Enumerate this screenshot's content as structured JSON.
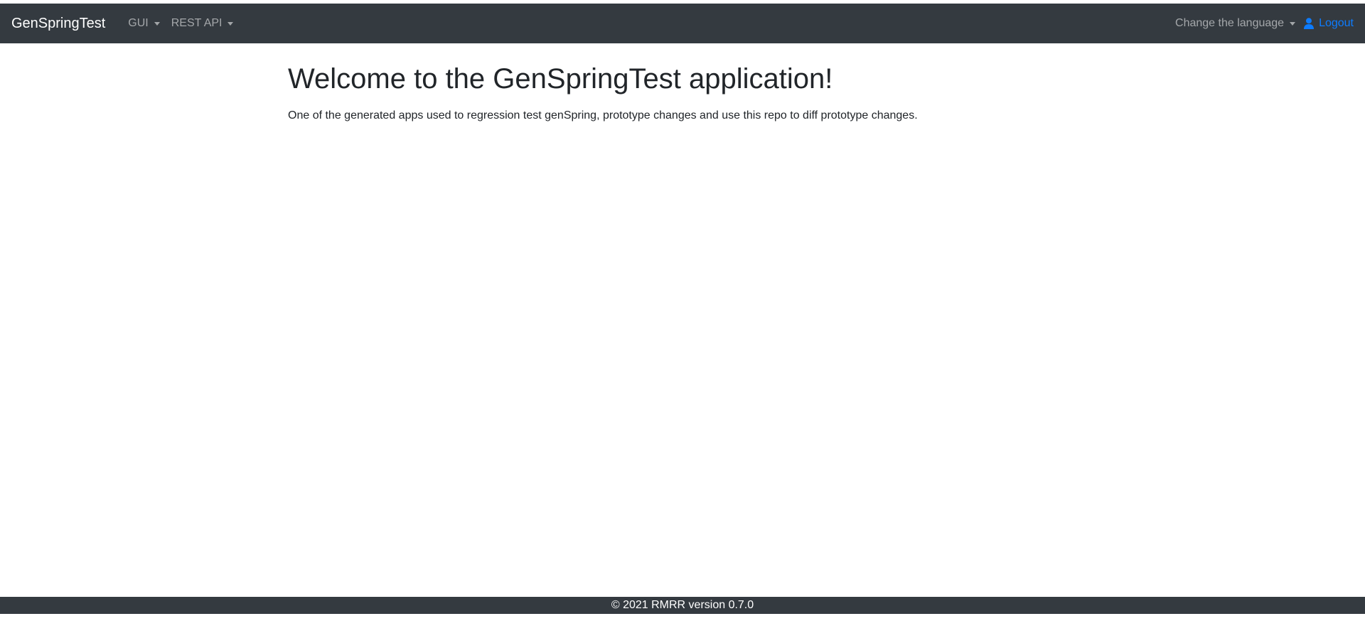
{
  "navbar": {
    "brand": "GenSpringTest",
    "menus": [
      {
        "label": "GUI"
      },
      {
        "label": "REST API"
      }
    ],
    "language_label": "Change the language",
    "logout_label": "Logout",
    "icons": {
      "logout": "user-icon",
      "dropdown": "caret-down-icon"
    }
  },
  "main": {
    "title": "Welcome to the GenSpringTest application!",
    "description": "One of the generated apps used to regression test genSpring, prototype changes and use this repo to diff prototype changes."
  },
  "footer": {
    "text": "© 2021 RMRR version 0.7.0"
  },
  "colors": {
    "navbar_bg": "#343a40",
    "link_accent": "#0d7cff"
  }
}
